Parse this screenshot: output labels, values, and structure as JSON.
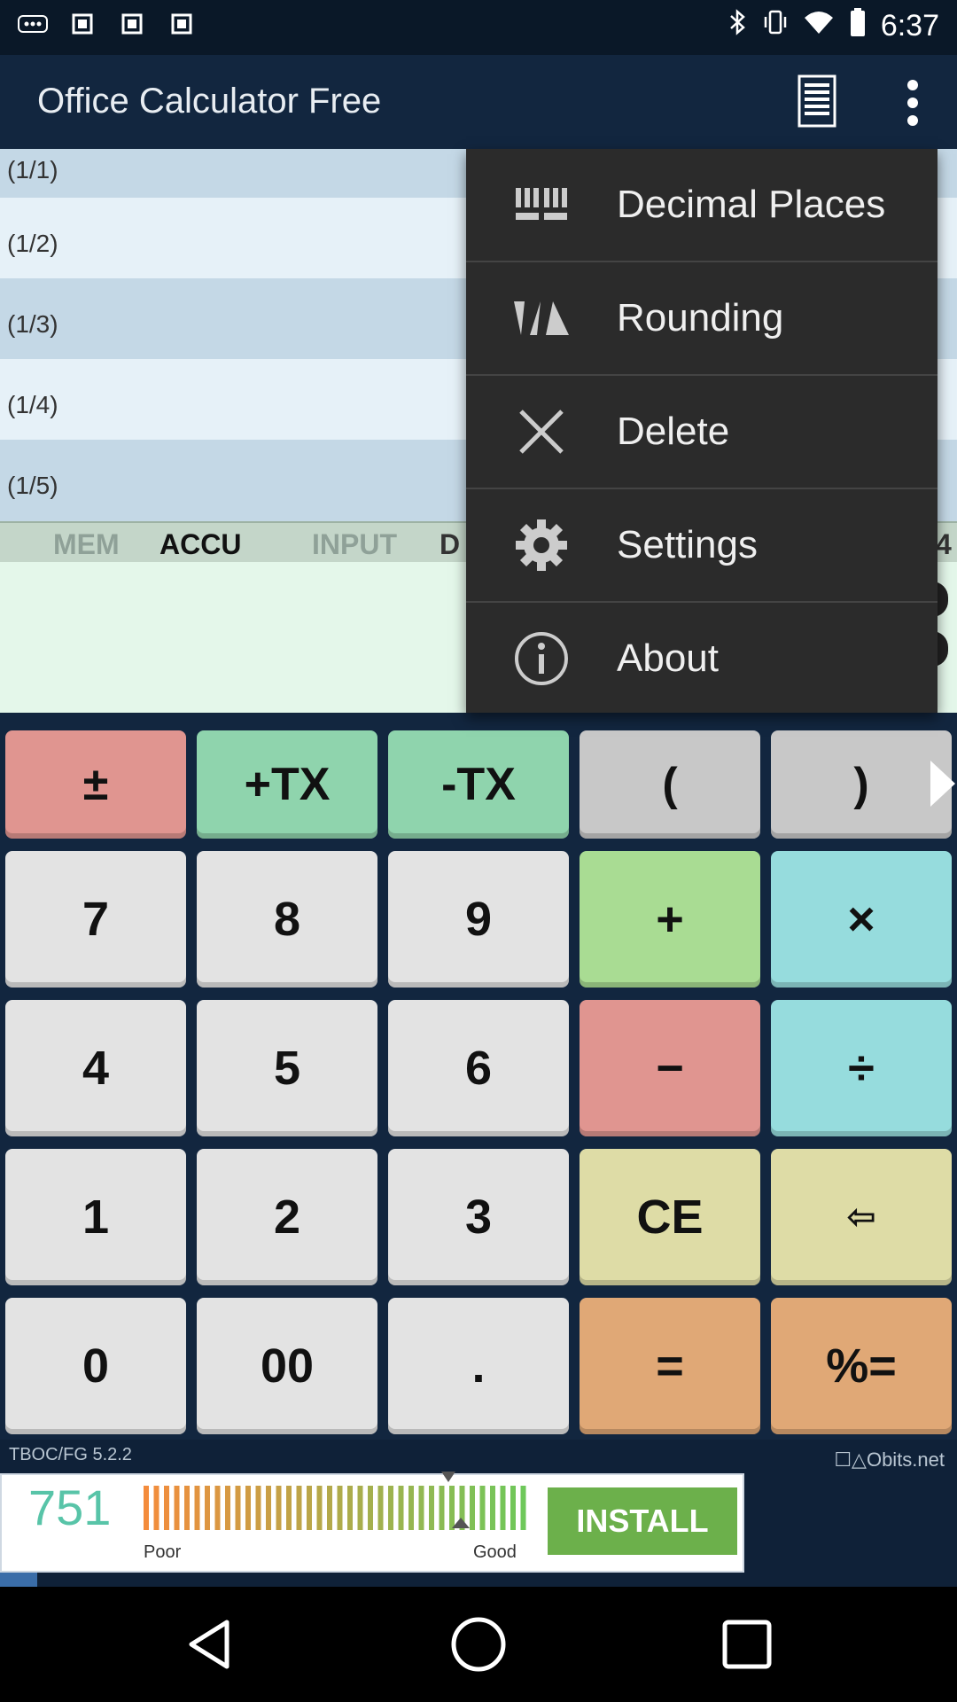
{
  "status_bar": {
    "time": "6:37",
    "icons": [
      "more-notifications-icon",
      "notification-icon",
      "notification-icon",
      "notification-icon",
      "bluetooth-icon",
      "vibrate-icon",
      "wifi-icon",
      "battery-icon"
    ]
  },
  "app_bar": {
    "title": "Office Calculator Free",
    "icons": [
      "tape-icon",
      "more-vert-icon"
    ]
  },
  "tape": {
    "rows": [
      "(1/1)",
      "(1/2)",
      "(1/3)",
      "(1/4)",
      "(1/5)"
    ]
  },
  "tabs": {
    "mem": "MEM",
    "accu": "ACCU",
    "input": "INPUT",
    "partial_left": "D",
    "partial_right": "4"
  },
  "menu": {
    "items": [
      {
        "label": "Decimal Places",
        "icon": "decimal-places-icon"
      },
      {
        "label": "Rounding",
        "icon": "rounding-icon"
      },
      {
        "label": "Delete",
        "icon": "close-icon"
      },
      {
        "label": "Settings",
        "icon": "gear-icon"
      },
      {
        "label": "About",
        "icon": "info-icon"
      }
    ]
  },
  "keypad": {
    "top_row": [
      "±",
      "+TX",
      "-TX",
      "(",
      ")"
    ],
    "rows": [
      [
        "7",
        "8",
        "9",
        "+",
        "×"
      ],
      [
        "4",
        "5",
        "6",
        "−",
        "÷"
      ],
      [
        "1",
        "2",
        "3",
        "CE",
        "⇦"
      ],
      [
        "0",
        "00",
        ".",
        "=",
        "%="
      ]
    ],
    "colors": {
      "digit": "#e3e3e3",
      "sign": "#e09590",
      "tax": "#8fd4ad",
      "paren": "#c8c8c8",
      "plus": "#a9dc93",
      "multiply": "#96dcdd",
      "minus": "#e09590",
      "divide": "#96dcdd",
      "ce": "#dedca6",
      "backspace": "#dedca6",
      "equals": "#e0a876",
      "percent_equals": "#e0a876"
    }
  },
  "footer": {
    "version": "TBOC/FG 5.2.2",
    "brand": "☐△Obits.net"
  },
  "ad": {
    "score": "751",
    "poor_label": "Poor",
    "good_label": "Good",
    "install_label": "INSTALL"
  },
  "nav_bar": {
    "icons": [
      "back-icon",
      "home-icon",
      "recents-icon"
    ]
  }
}
